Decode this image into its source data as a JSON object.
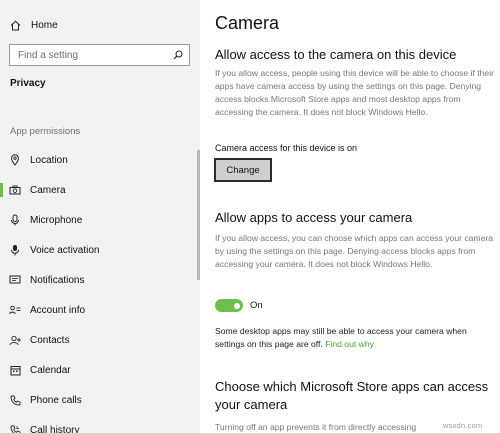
{
  "sidebar": {
    "home_label": "Home",
    "search_placeholder": "Find a setting",
    "section_title": "Privacy",
    "group_label": "App permissions",
    "items": [
      {
        "label": "Location",
        "icon": "location-icon",
        "active": false
      },
      {
        "label": "Camera",
        "icon": "camera-icon",
        "active": true
      },
      {
        "label": "Microphone",
        "icon": "microphone-icon",
        "active": false
      },
      {
        "label": "Voice activation",
        "icon": "voice-activation-icon",
        "active": false
      },
      {
        "label": "Notifications",
        "icon": "notifications-icon",
        "active": false
      },
      {
        "label": "Account info",
        "icon": "account-info-icon",
        "active": false
      },
      {
        "label": "Contacts",
        "icon": "contacts-icon",
        "active": false
      },
      {
        "label": "Calendar",
        "icon": "calendar-icon",
        "active": false
      },
      {
        "label": "Phone calls",
        "icon": "phone-calls-icon",
        "active": false
      },
      {
        "label": "Call history",
        "icon": "call-history-icon",
        "active": false
      }
    ]
  },
  "main": {
    "title": "Camera",
    "device_section": {
      "heading": "Allow access to the camera on this device",
      "description": "If you allow access, people using this device will be able to choose if their apps have camera access by using the settings on this page. Denying access blocks Microsoft Store apps and most desktop apps from accessing the camera. It does not block Windows Hello.",
      "status": "Camera access for this device is on",
      "change_label": "Change"
    },
    "apps_section": {
      "heading": "Allow apps to access your camera",
      "description": "If you allow access, you can choose which apps can access your camera by using the settings on this page. Denying access blocks apps from accessing your camera. It does not block Windows Hello.",
      "toggle_state": "On",
      "note": "Some desktop apps may still be able to access your camera when settings on this page are off.",
      "link": "Find out why"
    },
    "store_section": {
      "heading": "Choose which Microsoft Store apps can access your camera",
      "description": "Turning off an app prevents it from directly accessing"
    }
  },
  "watermark": "wsxdn.com",
  "colors": {
    "accent": "#6cc04a",
    "link": "#4a9e2e",
    "sidebar_bg": "#f2f2f2"
  }
}
